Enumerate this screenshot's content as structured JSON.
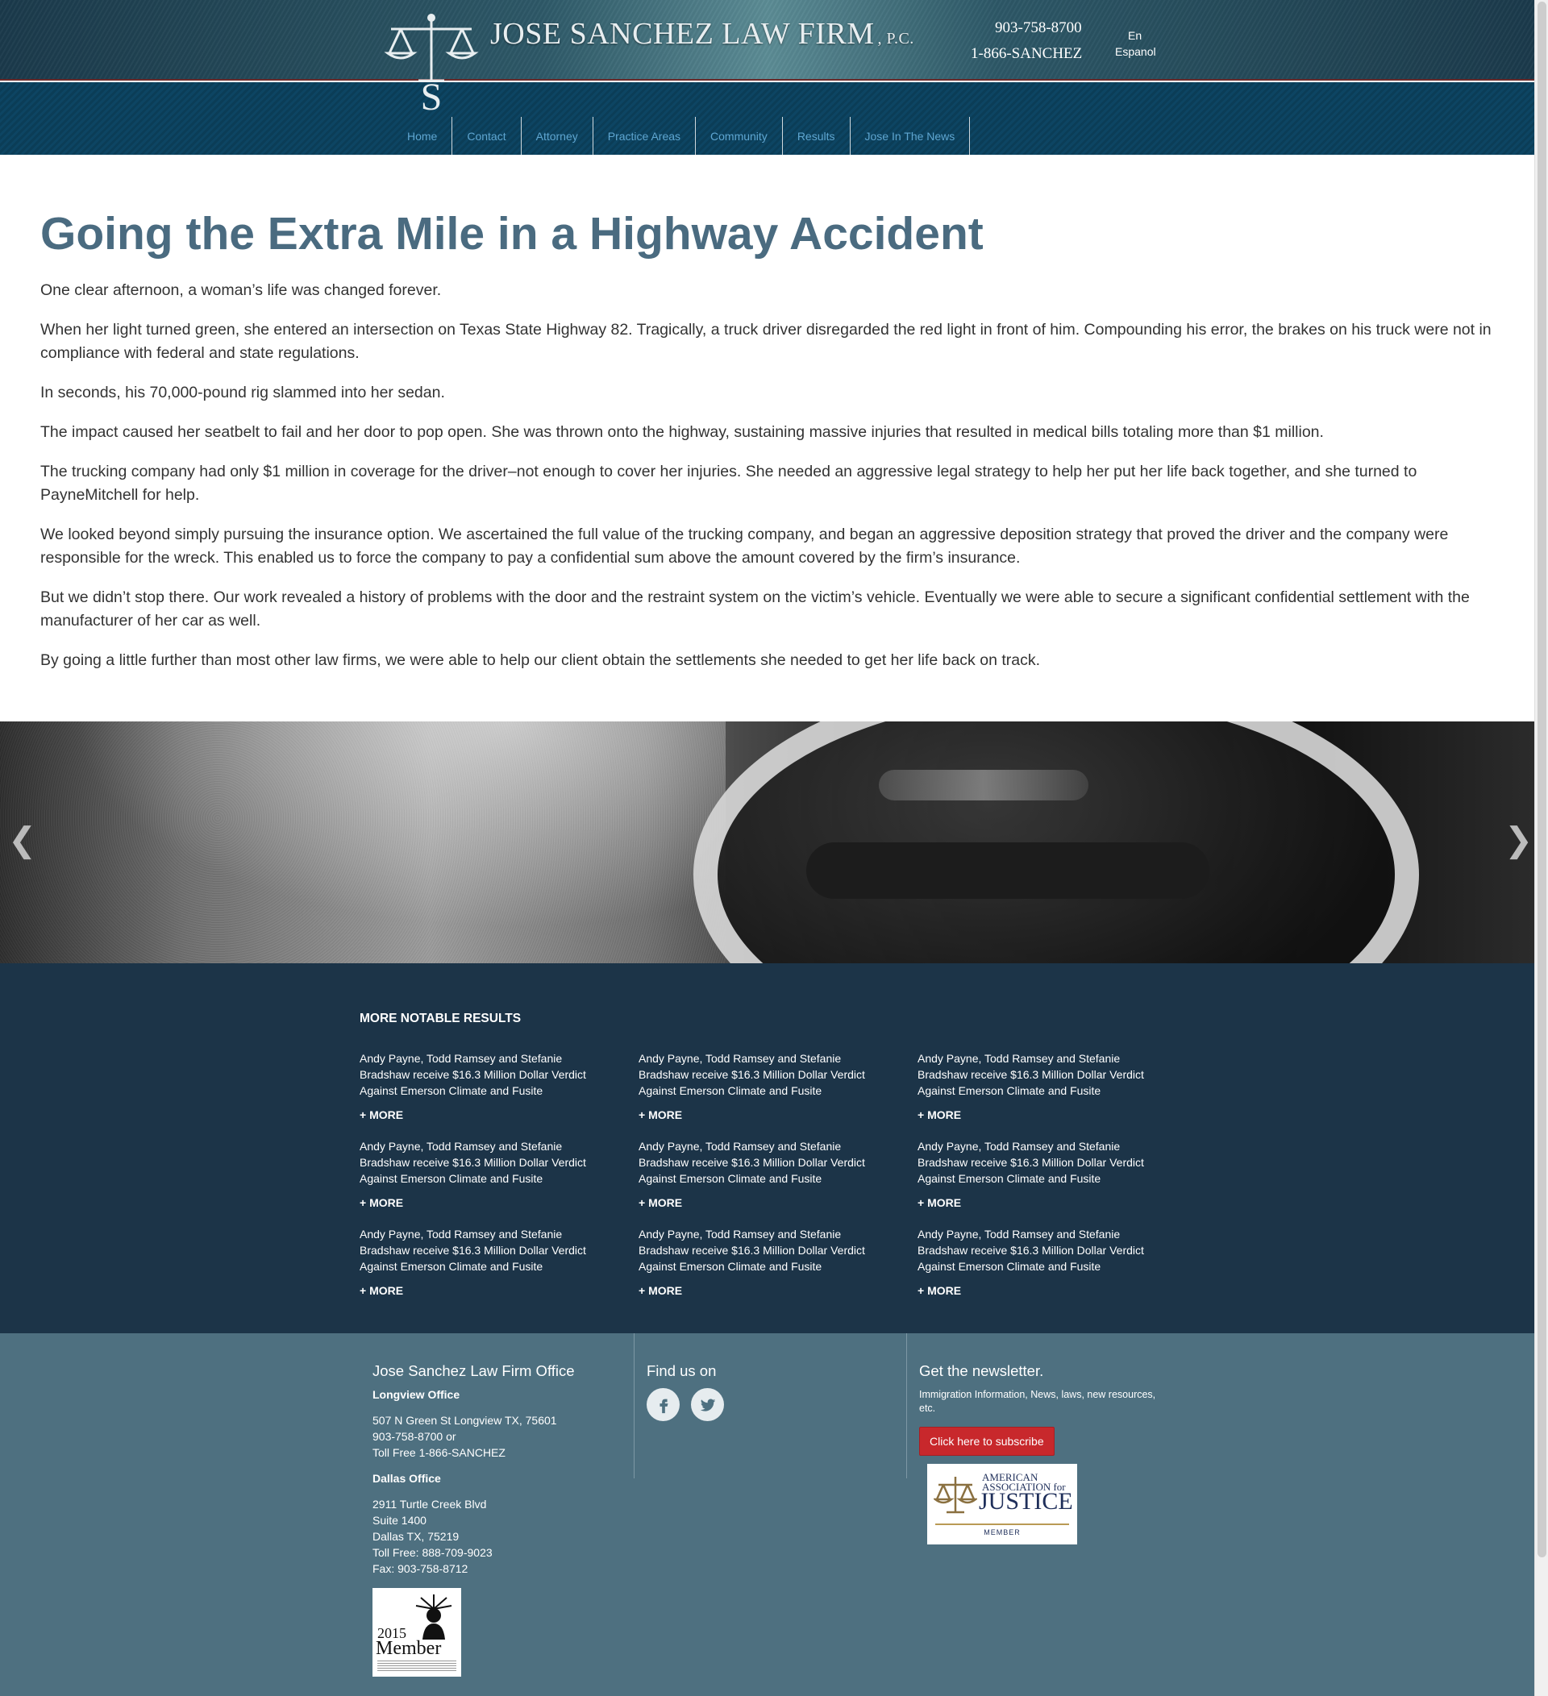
{
  "header": {
    "firm_name": "JOSE SANCHEZ LAW FIRM",
    "firm_suffix": "P.C.",
    "phone_local": "903-758-8700",
    "phone_toll": "1-866-SANCHEZ",
    "lang_en": "En",
    "lang_es": "Espanol",
    "logo_icon": "scales-of-justice-logo",
    "colors": {
      "nav_link": "#5fa6d1",
      "header_dark": "#1b3a4b",
      "nav_band": "#0b3d57"
    }
  },
  "nav": {
    "items": [
      {
        "label": "Home"
      },
      {
        "label": "Contact"
      },
      {
        "label": "Attorney"
      },
      {
        "label": "Practice Areas"
      },
      {
        "label": "Community"
      },
      {
        "label": "Results"
      },
      {
        "label": "Jose In The News"
      }
    ]
  },
  "article": {
    "title": "Going the Extra Mile in a Highway Accident",
    "paragraphs": [
      "One clear afternoon, a woman’s life was changed forever.",
      "When her light turned green, she entered an intersection on Texas State Highway 82. Tragically, a truck driver disregarded the red light in front of him. Compounding his error, the brakes on his truck were not in compliance with federal and state regulations.",
      "In seconds, his 70,000-pound rig slammed into her sedan.",
      "The impact caused her seatbelt to fail and her door to pop open. She was thrown onto the highway, sustaining massive injuries that resulted in medical bills totaling more than $1 million.",
      "The trucking company had only $1 million in coverage for the driver–not enough to cover her injuries. She needed an aggressive legal strategy to help her put her life back together, and she turned to PayneMitchell for help.",
      "We looked beyond simply pursuing the insurance option. We ascertained the full value of the trucking company, and began an aggressive deposition strategy that proved the driver and the company were responsible for the wreck. This enabled us to force the company to pay a confidential sum above the amount covered by the firm’s insurance.",
      "But we didn’t stop there. Our work revealed a history of problems with the door and the restraint system on the victim’s vehicle. Eventually we were able to secure a significant confidential settlement with the manufacturer of her car as well.",
      "By going a little further than most other law firms, we were able to help our client obtain the settlements she needed to get her life back on track."
    ]
  },
  "slider": {
    "prev_icon": "chevron-left-icon",
    "next_icon": "chevron-right-icon"
  },
  "results": {
    "title": "MORE NOTABLE RESULTS",
    "items": [
      {
        "text": "Andy Payne, Todd Ramsey and Stefanie Bradshaw receive $16.3 Million Dollar Verdict Against Emerson Climate and Fusite",
        "more": "+ MORE"
      },
      {
        "text": "Andy Payne, Todd Ramsey and Stefanie Bradshaw receive $16.3 Million Dollar Verdict Against Emerson Climate and Fusite",
        "more": "+ MORE"
      },
      {
        "text": "Andy Payne, Todd Ramsey and Stefanie Bradshaw receive $16.3 Million Dollar Verdict Against Emerson Climate and Fusite",
        "more": "+ MORE"
      },
      {
        "text": "Andy Payne, Todd Ramsey and Stefanie Bradshaw receive $16.3 Million Dollar Verdict Against Emerson Climate and Fusite",
        "more": "+ MORE"
      },
      {
        "text": "Andy Payne, Todd Ramsey and Stefanie Bradshaw receive $16.3 Million Dollar Verdict Against Emerson Climate and Fusite",
        "more": "+ MORE"
      },
      {
        "text": "Andy Payne, Todd Ramsey and Stefanie Bradshaw receive $16.3 Million Dollar Verdict Against Emerson Climate and Fusite",
        "more": "+ MORE"
      },
      {
        "text": "Andy Payne, Todd Ramsey and Stefanie Bradshaw receive $16.3 Million Dollar Verdict Against Emerson Climate and Fusite",
        "more": "+ MORE"
      },
      {
        "text": "Andy Payne, Todd Ramsey and Stefanie Bradshaw receive $16.3 Million Dollar Verdict Against Emerson Climate and Fusite",
        "more": "+ MORE"
      },
      {
        "text": "Andy Payne, Todd Ramsey and Stefanie Bradshaw receive $16.3 Million Dollar Verdict Against Emerson Climate and Fusite",
        "more": "+ MORE"
      }
    ]
  },
  "footer": {
    "office_title": "Jose Sanchez Law Firm Office",
    "longview_label": "Longview Office",
    "longview_lines": [
      "507 N Green St Longview TX, 75601",
      "903-758-8700 or",
      "Toll Free 1-866-SANCHEZ"
    ],
    "dallas_label": "Dallas Office",
    "dallas_lines": [
      "2911 Turtle Creek Blvd",
      "Suite 1400",
      "Dallas TX, 75219",
      "Toll Free: 888-709-9023",
      "Fax: 903-758-8712"
    ],
    "member_badge": {
      "year": "2015",
      "member": "Member"
    },
    "find_us": "Find us on",
    "facebook_icon": "facebook-icon",
    "twitter_icon": "twitter-icon",
    "newsletter_title": "Get the newsletter.",
    "newsletter_sub": "Immigration Information, News, laws, new resources, etc.",
    "subscribe_label": "Click here to subscribe",
    "aaj_badge": {
      "line1": "AMERICAN",
      "line2": "ASSOCIATION for",
      "line3": "JUSTICE",
      "line4": "MEMBER"
    }
  }
}
